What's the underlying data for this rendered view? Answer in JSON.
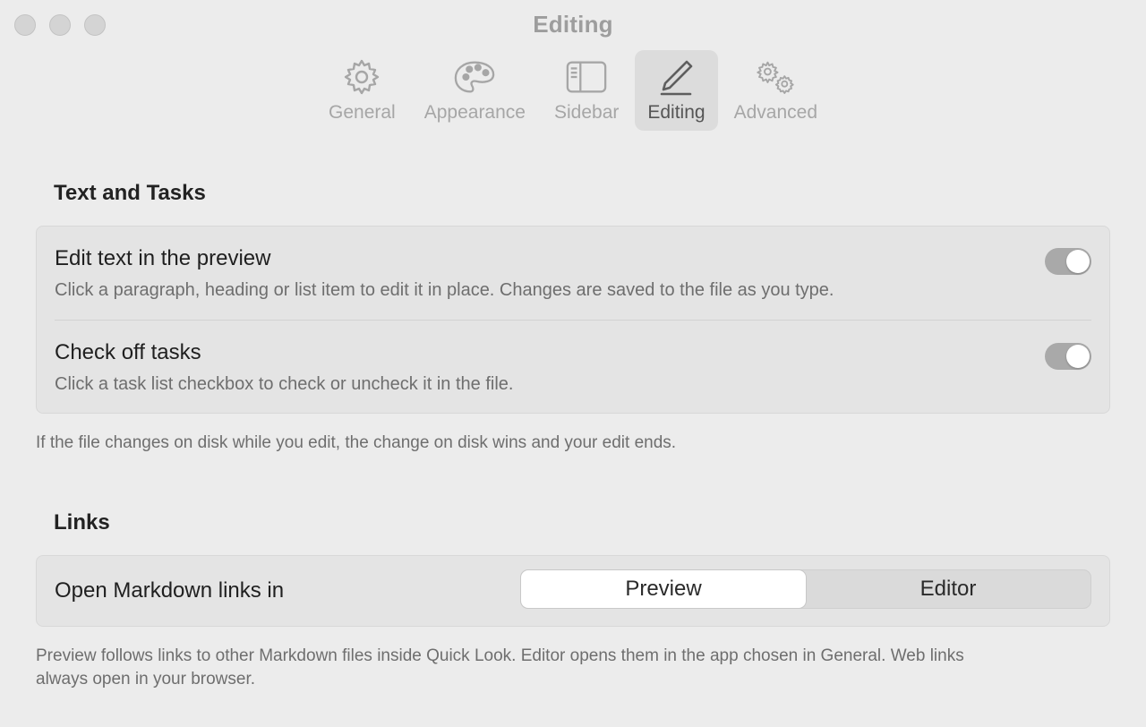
{
  "window": {
    "title": "Editing"
  },
  "toolbar": {
    "items": [
      {
        "label": "General",
        "icon": "gear-icon"
      },
      {
        "label": "Appearance",
        "icon": "palette-icon"
      },
      {
        "label": "Sidebar",
        "icon": "sidebar-icon"
      },
      {
        "label": "Editing",
        "icon": "pencil-icon",
        "active": true
      },
      {
        "label": "Advanced",
        "icon": "gears-icon"
      }
    ]
  },
  "text_tasks": {
    "heading": "Text and Tasks",
    "edit_preview": {
      "title": "Edit text in the preview",
      "desc": "Click a paragraph, heading or list item to edit it in place. Changes are saved to the file as you type.",
      "enabled": true
    },
    "check_tasks": {
      "title": "Check off tasks",
      "desc": "Click a task list checkbox to check or uncheck it in the file.",
      "enabled": true
    },
    "note": "If the file changes on disk while you edit, the change on disk wins and your edit ends."
  },
  "links": {
    "heading": "Links",
    "open_label": "Open Markdown links in",
    "options": [
      "Preview",
      "Editor"
    ],
    "selected": "Preview",
    "note_line1": "Preview follows links to other Markdown files inside Quick Look. Editor opens them in the app chosen in General. Web links",
    "note_line2": "always open in your browser."
  },
  "colors": {
    "background": "#ececec",
    "toggle_on": "#a9a9a9",
    "active_tab": "#dcdcdc"
  }
}
